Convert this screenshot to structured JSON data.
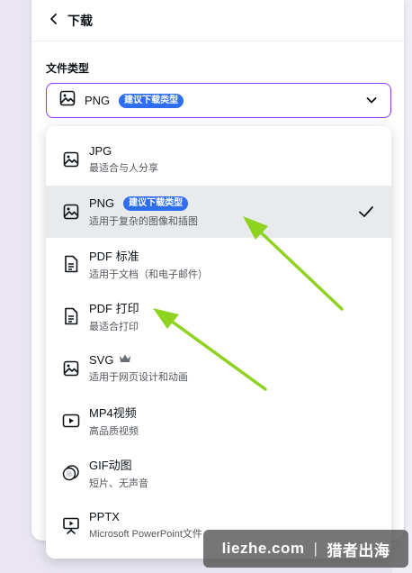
{
  "header": {
    "title": "下载",
    "back_icon": "chevron-left-icon"
  },
  "file_type": {
    "label": "文件类型",
    "selected": "PNG",
    "selected_badge": "建议下载类型"
  },
  "options": [
    {
      "name": "JPG",
      "desc": "最适合与人分享",
      "icon": "image-icon"
    },
    {
      "name": "PNG",
      "desc": "适用于复杂的图像和插图",
      "icon": "image-icon",
      "badge": "建议下载类型",
      "selected": true
    },
    {
      "name": "PDF 标准",
      "desc": "适用于文档（和电子邮件）",
      "icon": "document-icon"
    },
    {
      "name": "PDF 打印",
      "desc": "最适合打印",
      "icon": "document-icon"
    },
    {
      "name": "SVG",
      "desc": "适用于网页设计和动画",
      "icon": "image-icon",
      "premium": true
    },
    {
      "name": "MP4视频",
      "desc": "高品质视频",
      "icon": "video-icon"
    },
    {
      "name": "GIF动图",
      "desc": "短片、无声音",
      "icon": "gif-icon"
    },
    {
      "name": "PPTX",
      "desc": "Microsoft PowerPoint文件",
      "icon": "presentation-icon"
    }
  ],
  "watermark": {
    "site": "liezhe.com",
    "brand": "猎者出海"
  },
  "colors": {
    "accent": "#8b3dff",
    "badge": "#2f6ef2",
    "arrow": "#8ed320"
  }
}
